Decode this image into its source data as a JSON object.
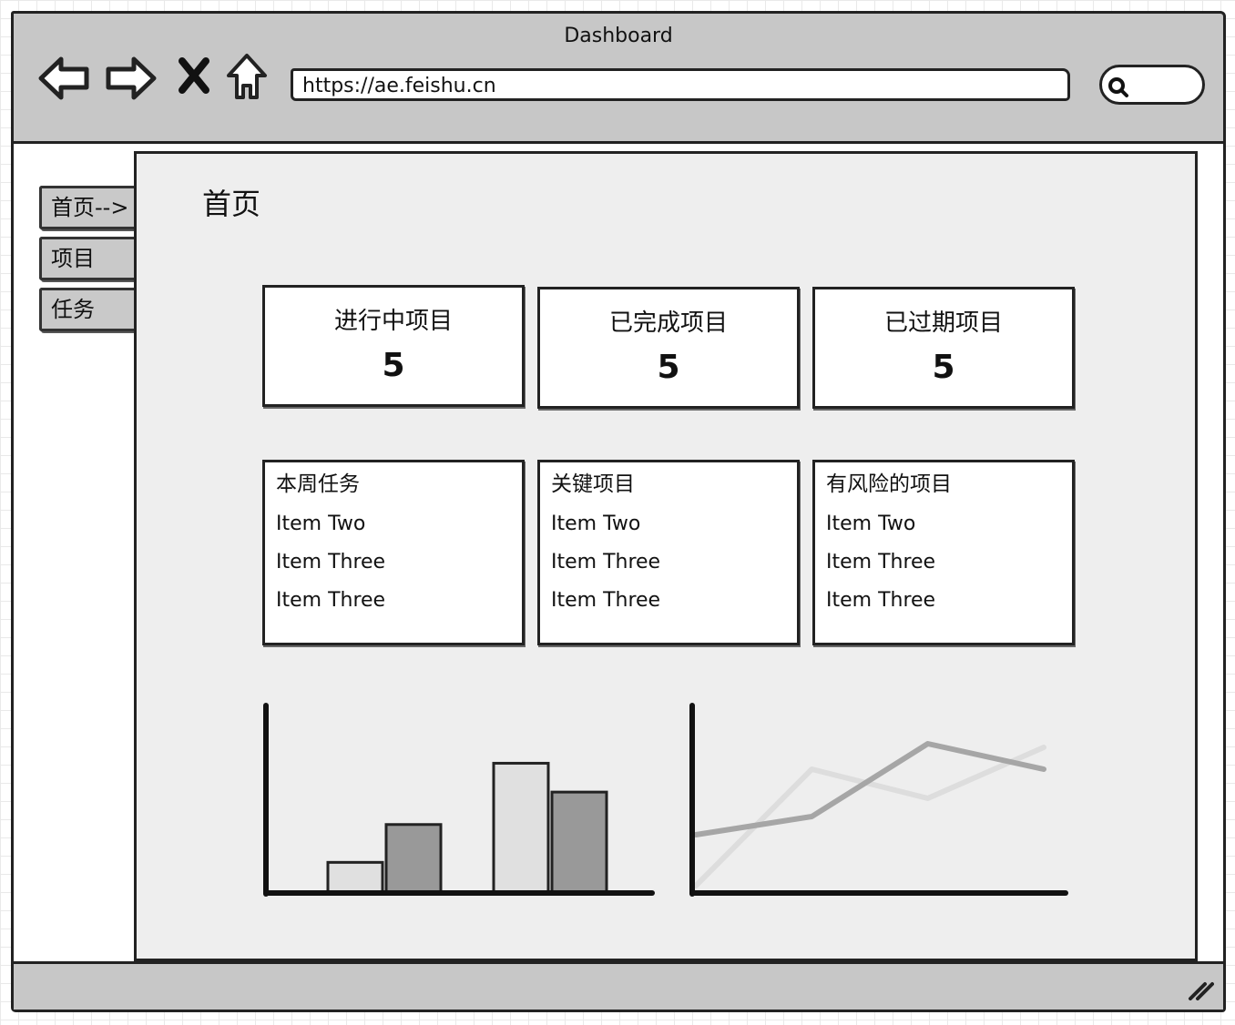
{
  "window": {
    "title": "Dashboard"
  },
  "toolbar": {
    "url": "https://ae.feishu.cn"
  },
  "sidebar": {
    "items": [
      {
        "label": "首页-->"
      },
      {
        "label": "项目"
      },
      {
        "label": "任务"
      }
    ]
  },
  "main": {
    "title": "首页",
    "stats": [
      {
        "label": "进行中项目",
        "value": "5"
      },
      {
        "label": "已完成项目",
        "value": "5"
      },
      {
        "label": "已过期项目",
        "value": "5"
      }
    ],
    "lists": [
      {
        "title": "本周任务",
        "items": [
          "Item Two",
          "Item Three",
          "Item Three"
        ]
      },
      {
        "title": "关键项目",
        "items": [
          "Item Two",
          "Item Three",
          "Item Three"
        ]
      },
      {
        "title": "有风险的项目",
        "items": [
          "Item Two",
          "Item Three",
          "Item Three"
        ]
      }
    ]
  },
  "chart_data": [
    {
      "type": "bar",
      "categories": [
        "",
        ""
      ],
      "series": [
        {
          "values": [
            0.17,
            0.72
          ],
          "color": "#e0e0e0"
        },
        {
          "values": [
            0.38,
            0.56
          ],
          "color": "#999999"
        }
      ],
      "ylim": [
        0,
        1
      ]
    },
    {
      "type": "line",
      "x": [
        0,
        1,
        2,
        3
      ],
      "series": [
        {
          "values": [
            0.3,
            0.4,
            0.8,
            0.66
          ],
          "color": "#a6a6a6"
        },
        {
          "values": [
            0.02,
            0.66,
            0.5,
            0.78
          ],
          "color": "#dddddd"
        }
      ],
      "ylim": [
        0,
        1
      ]
    }
  ],
  "colors": {
    "chrome": "#c7c7c7",
    "panel": "#eeeeee",
    "ink": "#222222"
  },
  "icons": [
    "back-arrow-icon",
    "forward-arrow-icon",
    "close-x-icon",
    "home-icon",
    "search-icon",
    "resize-grip-icon"
  ]
}
